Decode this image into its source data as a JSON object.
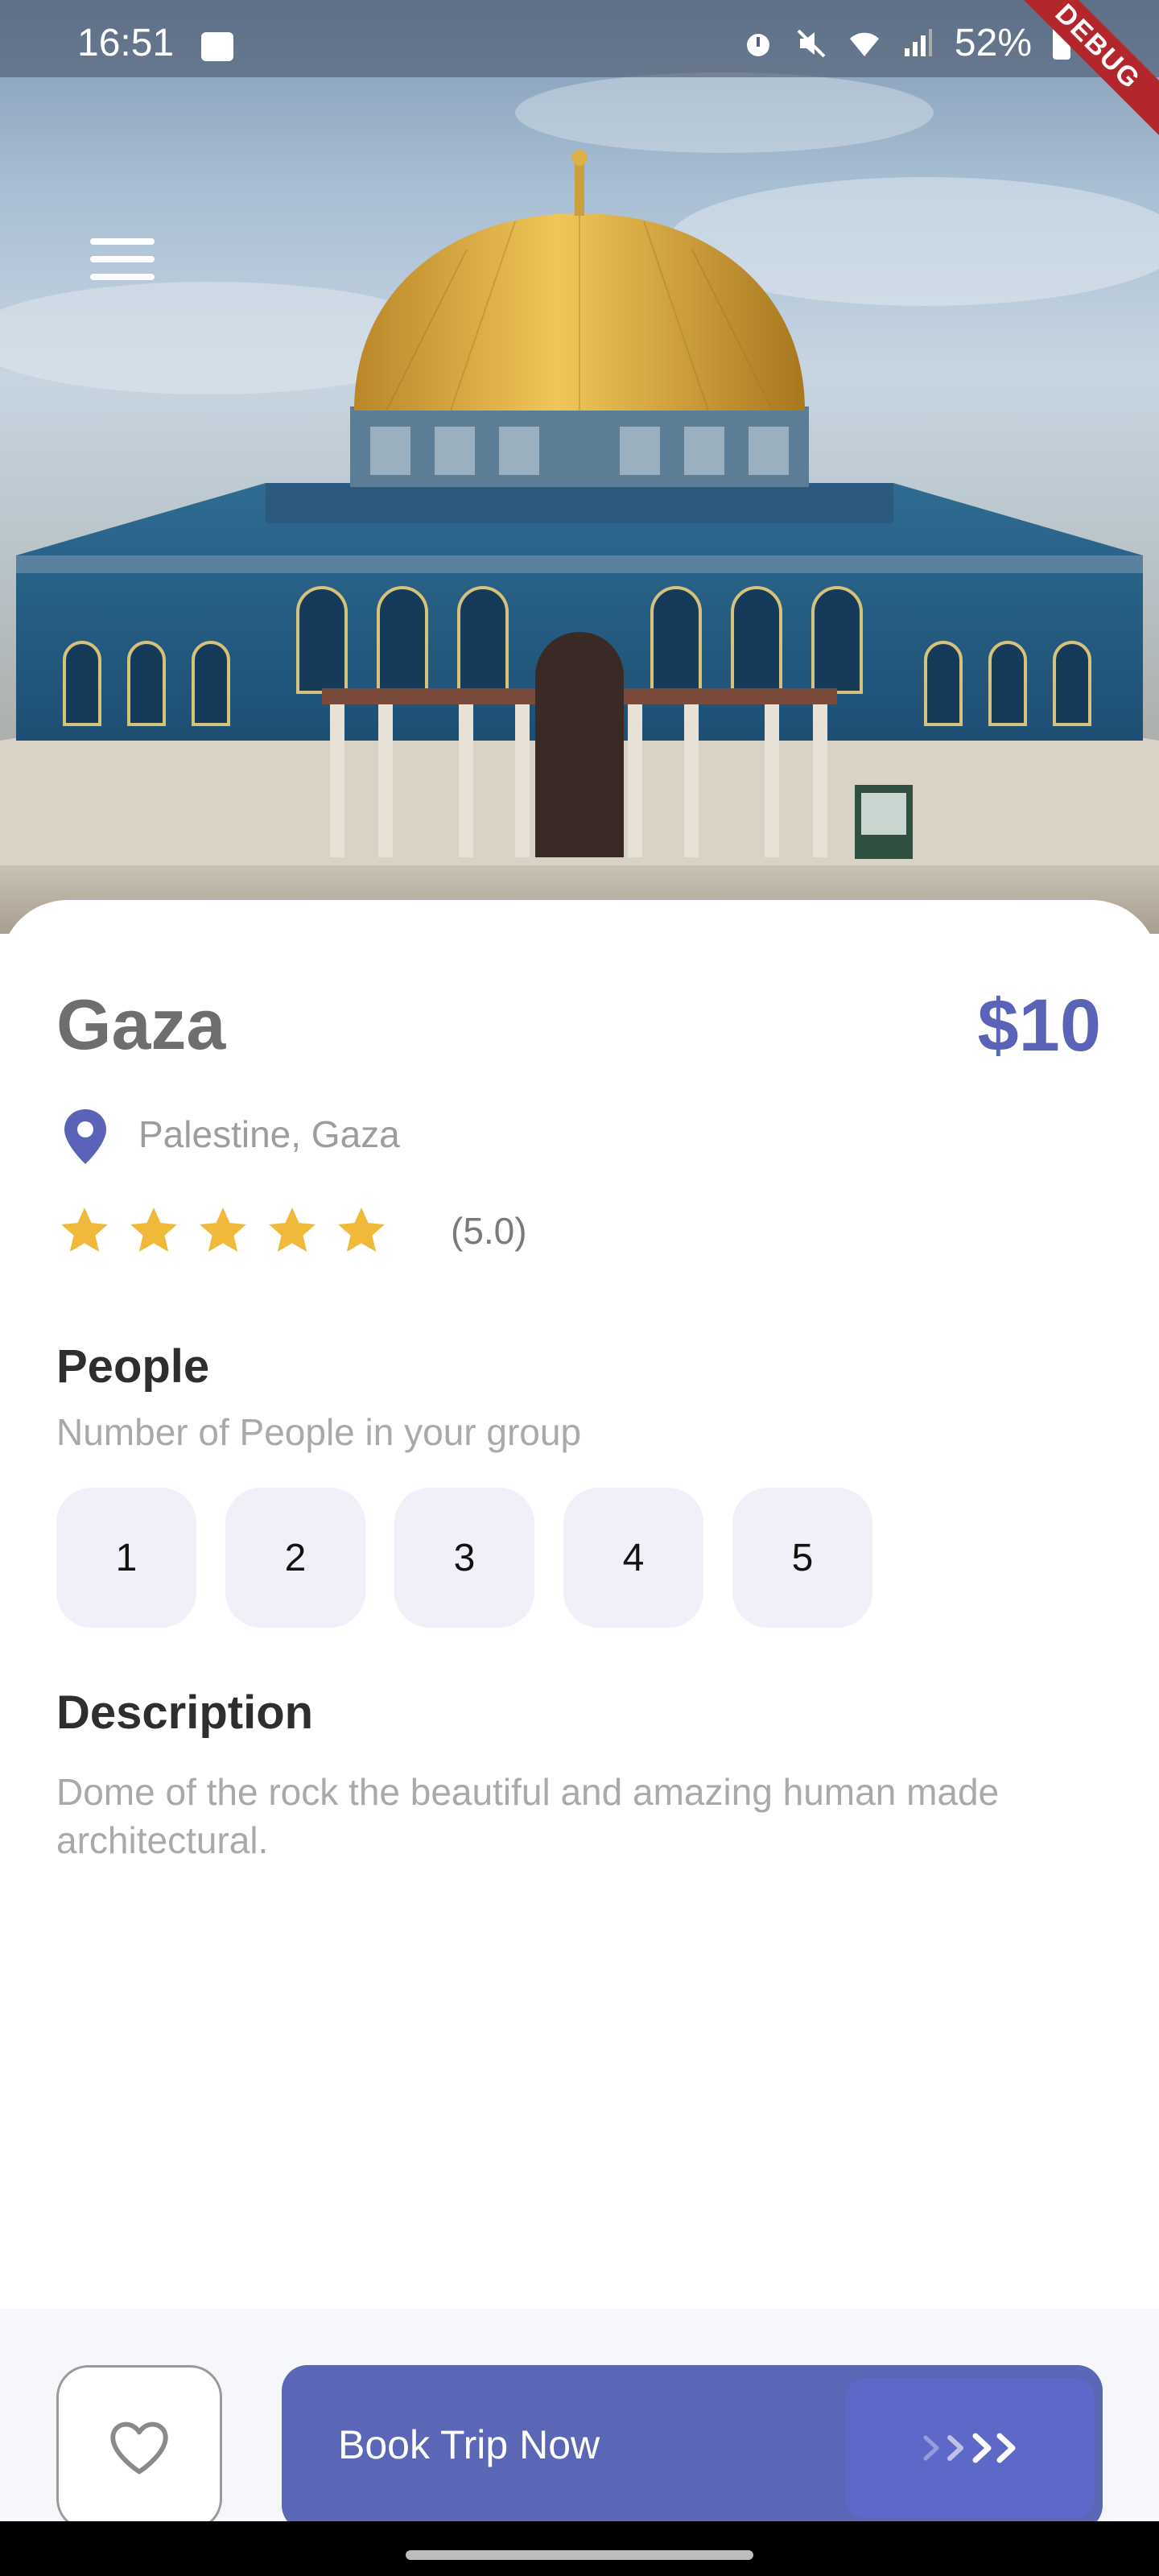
{
  "status_bar": {
    "time": "16:51",
    "battery": "52%",
    "icons": [
      "image-icon",
      "alarm-icon",
      "mute-icon",
      "wifi-icon",
      "signal-icon",
      "battery-icon"
    ]
  },
  "debug_banner": "DEBUG",
  "destination": {
    "title": "Gaza",
    "price": "$10",
    "location": "Palestine, Gaza",
    "rating": 5,
    "rating_text": "(5.0)"
  },
  "people": {
    "title": "People",
    "subtitle": "Number of People in your group",
    "options": [
      "1",
      "2",
      "3",
      "4",
      "5"
    ]
  },
  "description": {
    "title": "Description",
    "text": "Dome of the rock the beautiful and amazing human made architectural."
  },
  "actions": {
    "book_label": "Book Trip Now"
  },
  "colors": {
    "accent": "#5a63b8",
    "star": "#f0b93a",
    "option_bg": "#eff0f8"
  }
}
